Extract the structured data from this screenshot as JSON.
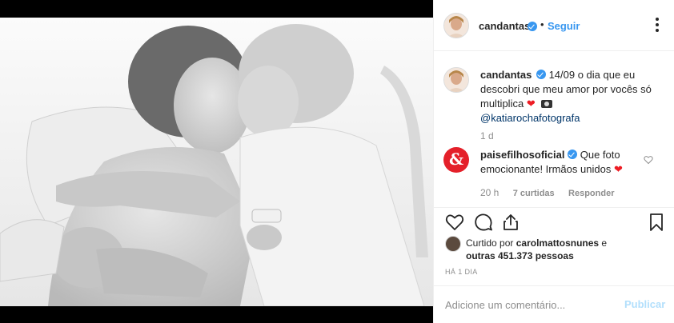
{
  "post": {
    "author": "candantas",
    "follow_label": "Seguir",
    "separator": "•",
    "photo_alt": "",
    "caption": {
      "username": "candantas",
      "text": "14/09 o dia que eu descobri que meu amor por vocês só multiplica",
      "heart": "❤",
      "mention": "@katiarochafotografa",
      "time": "1 d"
    },
    "comments": [
      {
        "avatar_glyph": "&",
        "username": "paisefilhosoficial",
        "text": "Que foto emocionante! Irmãos unidos",
        "heart": "❤",
        "time": "20 h",
        "likes": "7 curtidas",
        "reply_label": "Responder"
      }
    ],
    "likes": {
      "prefix": "Curtido por",
      "user": "carolmattosnunes",
      "and": "e",
      "others": "outras 451.373 pessoas"
    },
    "age": "HÁ 1 DIA",
    "add_comment": {
      "placeholder": "Adicione um comentário...",
      "publish_label": "Publicar"
    }
  },
  "colors": {
    "link_blue": "#3897f0",
    "mention": "#003569",
    "heart_red": "#ed1c24",
    "secondary_text": "#8e8e8e",
    "publish_disabled": "#b2dffc",
    "border": "#efefef"
  },
  "icons": {
    "more": "more-options-icon",
    "like": "heart-outline-icon",
    "comment": "comment-bubble-icon",
    "share": "share-upload-icon",
    "save": "bookmark-icon",
    "verified": "verified-badge-icon",
    "camera": "camera-icon"
  }
}
